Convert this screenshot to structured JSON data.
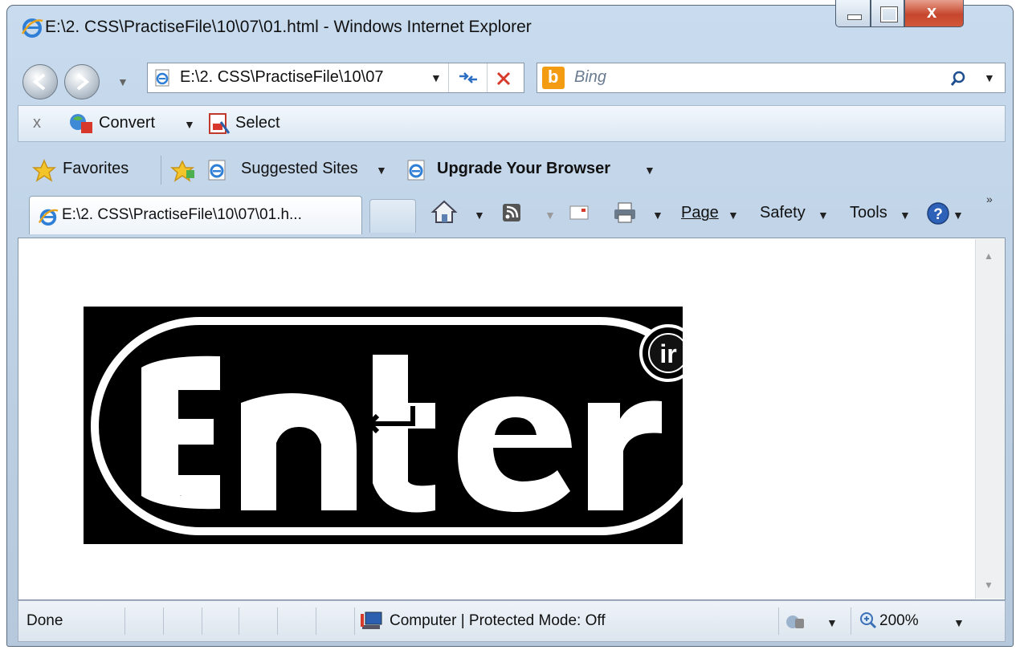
{
  "window": {
    "title": "E:\\2. CSS\\PractiseFile\\10\\07\\01.html - Windows Internet Explorer"
  },
  "address_bar": {
    "url": "E:\\2. CSS\\PractiseFile\\10\\07"
  },
  "search": {
    "placeholder": "Bing"
  },
  "command_bar": {
    "convert_label": "Convert",
    "select_label": "Select"
  },
  "favorites_bar": {
    "favorites_label": "Favorites",
    "suggested_sites_label": "Suggested Sites",
    "upgrade_label": "Upgrade Your Browser"
  },
  "tabs": [
    {
      "label": "E:\\2. CSS\\PractiseFile\\10\\07\\01.h..."
    }
  ],
  "toolbar": {
    "page_label": "Page",
    "safety_label": "Safety",
    "tools_label": "Tools"
  },
  "content": {
    "logo_text": "Enter"
  },
  "status_bar": {
    "status_text": "Done",
    "zone_text": "Computer | Protected Mode: Off",
    "zoom_text": "200%"
  },
  "icons": [
    "ie-logo-icon",
    "back-icon",
    "forward-icon",
    "refresh-icon",
    "stop-icon",
    "bing-icon",
    "search-icon",
    "close-icon",
    "convert-icon",
    "pdf-select-icon",
    "favorites-star-icon",
    "add-favorite-icon",
    "home-icon",
    "feeds-icon",
    "mail-icon",
    "print-icon",
    "help-icon",
    "computer-icon",
    "protected-mode-icon",
    "zoom-icon"
  ],
  "colors": {
    "frame": "#bccfe3",
    "close_button": "#c6462d",
    "bing_orange": "#f39c12"
  }
}
